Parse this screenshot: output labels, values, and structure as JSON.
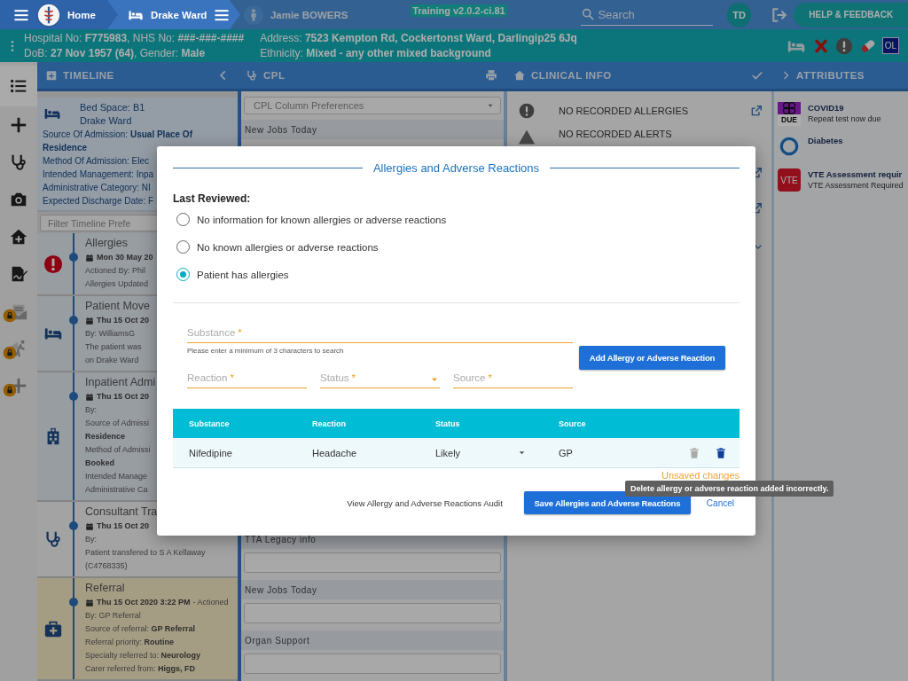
{
  "top_bar": {
    "breadcrumbs": [
      {
        "kind": "home",
        "label": "Home"
      },
      {
        "kind": "ward",
        "label": "Drake Ward"
      },
      {
        "kind": "patient",
        "label": "Jamie BOWERS"
      }
    ],
    "environment": "Training v2.0.2-ci.81",
    "search": {
      "placeholder": "Search"
    },
    "user_initials": "TD",
    "help_button": "HELP & FEEDBACK"
  },
  "patient_banner": {
    "lines": [
      "Hospital No: **F775983**, NHS No: **###-###-####**",
      "DoB: **27 Nov 1957 (64)**, Gender: **Male**",
      "Address: **7523 Kempton Rd, Cockertonst Ward, Darlingip25 6Jq**",
      "Ethnicity: **Mixed - any other mixed background**"
    ],
    "alert_badge": "OL"
  },
  "side_rail": {
    "items": [
      {
        "kind": "list",
        "selected": true,
        "locked": false
      },
      {
        "kind": "plus",
        "selected": false,
        "locked": false
      },
      {
        "kind": "stethoscope",
        "selected": false,
        "locked": false
      },
      {
        "kind": "camera",
        "selected": false,
        "locked": false
      },
      {
        "kind": "house",
        "selected": false,
        "locked": false
      },
      {
        "kind": "document",
        "selected": false,
        "locked": false
      },
      {
        "kind": "envelope",
        "selected": false,
        "locked": true
      },
      {
        "kind": "walker",
        "selected": false,
        "locked": true
      },
      {
        "kind": "plus",
        "selected": false,
        "locked": true
      }
    ]
  },
  "column_headers": [
    {
      "kind": "timeline",
      "title": "TIMELINE"
    },
    {
      "kind": "cpl",
      "title": "CPL"
    },
    {
      "kind": "clinical",
      "title": "CLINICAL INFO"
    },
    {
      "kind": "attributes",
      "title": "ATTRIBUTES"
    }
  ],
  "timeline": {
    "summary": {
      "bed_space": "Bed Space: B1",
      "ward": "Drake Ward",
      "details": [
        "Source Of Admission: **Usual Place Of Residence**",
        "Method Of Admission: Elec",
        "Intended Management: Inpa",
        "Administrative Category: NI",
        "Expected Discharge Date: F"
      ]
    },
    "filter": {
      "placeholder": "Filter Timeline Prefe"
    },
    "events": [
      {
        "kind": "allergy",
        "title": "Allergies",
        "date": "Mon 30 May 20",
        "lines": [
          "Actioned By: Phil",
          "Allergies Updated"
        ]
      },
      {
        "kind": "move",
        "title": "Patient Move",
        "date": "Thu 15 Oct 20",
        "lines": [
          "By: WilliamsG",
          "The patient was",
          "on Drake Ward"
        ]
      },
      {
        "kind": "admission",
        "title": "Inpatient Admi",
        "date": "Thu 15 Oct 20",
        "lines": [
          "By:",
          "Source of Admissi",
          "**Residence**",
          "Method of Admissi",
          "**Booked**",
          "Intended Manage",
          "Administrative Ca"
        ]
      },
      {
        "kind": "consultant",
        "title": "Consultant Tra",
        "date": "Thu 15 Oct 20",
        "lines": [
          "By:",
          "Patient transfered to S A Kellaway",
          "(C4768335)"
        ]
      },
      {
        "kind": "referral",
        "title": "Referral",
        "date": "Thu 15 Oct 2020 3:22 PM",
        "date_suffix": "- Actioned",
        "lines": [
          "By: GP Referral",
          "Source of referral: **GP Referral**",
          "Referral priority: **Routine**",
          "Specialty referred to: **Neurology**",
          "Carer referred from: **Higgs, FD**"
        ]
      }
    ]
  },
  "cpl": {
    "preferences": {
      "placeholder": "CPL Column Preferences"
    },
    "top_sections": [
      {
        "label": "New Jobs Today"
      }
    ],
    "bottom_sections": [
      {
        "label": "TTA Legacy info"
      },
      {
        "label": "New Jobs Today"
      },
      {
        "label": "Organ Support"
      }
    ]
  },
  "clinical_info": {
    "items": [
      {
        "kind": "allergies",
        "text": "NO RECORDED ALLERGIES",
        "link": true
      },
      {
        "kind": "alerts",
        "text": "NO RECORDED ALERTS",
        "link": false
      },
      {
        "kind": "covered",
        "link": true
      },
      {
        "kind": "covered",
        "link": true
      }
    ]
  },
  "attributes": {
    "items": [
      {
        "kind": "due",
        "badge": "DUE",
        "title": "COVID19",
        "note": "Repeat test now due"
      },
      {
        "kind": "ring",
        "title": "Diabetes"
      },
      {
        "kind": "vte",
        "badge": "VTE",
        "title": "VTE Assessment requir",
        "note": "VTE Assessment Required"
      }
    ]
  },
  "dialog": {
    "title": "Allergies and Adverse Reactions",
    "last_reviewed": "Last Reviewed:",
    "options": [
      {
        "label": "No information for known allergies or adverse reactions",
        "selected": false
      },
      {
        "label": "No known allergies or adverse reactions",
        "selected": false
      },
      {
        "label": "Patient has allergies",
        "selected": true
      }
    ],
    "substance": {
      "placeholder": "Substance",
      "mark": "*",
      "hint": "Please enter a minimum of 3 characters to search"
    },
    "fields": [
      {
        "kind": "text",
        "placeholder": "Reaction",
        "mark": "*"
      },
      {
        "kind": "select",
        "placeholder": "Status",
        "mark": "*"
      },
      {
        "kind": "text",
        "placeholder": "Source",
        "mark": "*"
      }
    ],
    "add_button": "Add Allergy or Adverse Reaction",
    "table": {
      "columns": [
        "Substance",
        "Reaction",
        "Status",
        "Source"
      ],
      "rows": [
        {
          "substance": "Nifedipine",
          "reaction": "Headache",
          "status": "Likely",
          "source": "GP"
        }
      ]
    },
    "unsaved_notice": "Unsaved changes",
    "tooltip": "Delete allergy or adverse reaction added incorrectly.",
    "audit_link": "View Allergy and Adverse Reactions Audit",
    "save_button": "Save Allergies and Adverse Reactions",
    "cancel_button": "Cancel"
  }
}
